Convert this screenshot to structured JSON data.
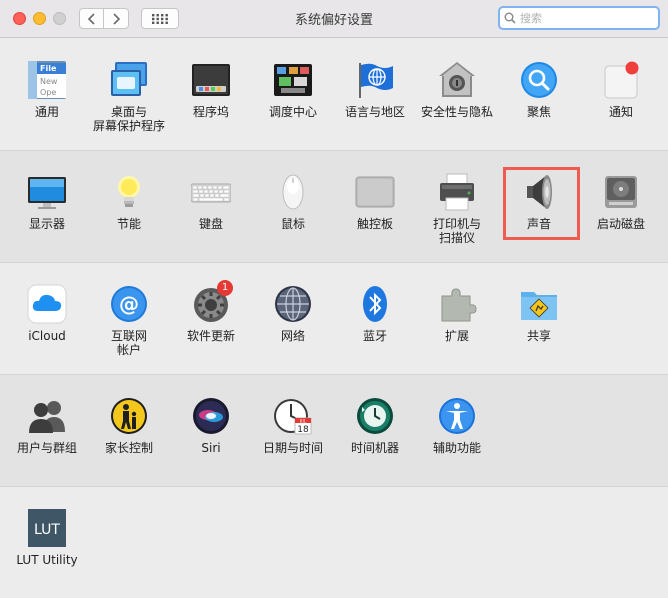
{
  "window": {
    "title": "系统偏好设置",
    "search_placeholder": "搜索"
  },
  "rows": [
    [
      {
        "label": "通用",
        "icon": "general-icon",
        "lines": [
          "通用"
        ]
      },
      {
        "label": "桌面与屏幕保护程序",
        "icon": "desktop-screensaver-icon",
        "lines": [
          "桌面与",
          "屏幕保护程序"
        ]
      },
      {
        "label": "程序坞",
        "icon": "dock-icon",
        "lines": [
          "程序坞"
        ]
      },
      {
        "label": "调度中心",
        "icon": "mission-control-icon",
        "lines": [
          "调度中心"
        ]
      },
      {
        "label": "语言与地区",
        "icon": "language-region-icon",
        "lines": [
          "语言与地区"
        ]
      },
      {
        "label": "安全性与隐私",
        "icon": "security-privacy-icon",
        "lines": [
          "安全性与隐私"
        ]
      },
      {
        "label": "聚焦",
        "icon": "spotlight-icon",
        "lines": [
          "聚焦"
        ]
      },
      {
        "label": "通知",
        "icon": "notifications-icon",
        "lines": [
          "通知"
        ]
      }
    ],
    [
      {
        "label": "显示器",
        "icon": "displays-icon",
        "lines": [
          "显示器"
        ]
      },
      {
        "label": "节能",
        "icon": "energy-saver-icon",
        "lines": [
          "节能"
        ]
      },
      {
        "label": "键盘",
        "icon": "keyboard-icon",
        "lines": [
          "键盘"
        ]
      },
      {
        "label": "鼠标",
        "icon": "mouse-icon",
        "lines": [
          "鼠标"
        ]
      },
      {
        "label": "触控板",
        "icon": "trackpad-icon",
        "lines": [
          "触控板"
        ]
      },
      {
        "label": "打印机与扫描仪",
        "icon": "printer-scanner-icon",
        "lines": [
          "打印机与",
          "扫描仪"
        ]
      },
      {
        "label": "声音",
        "icon": "sound-icon",
        "lines": [
          "声音"
        ]
      },
      {
        "label": "启动磁盘",
        "icon": "startup-disk-icon",
        "lines": [
          "启动磁盘"
        ]
      }
    ],
    [
      {
        "label": "iCloud",
        "icon": "icloud-icon",
        "lines": [
          "iCloud"
        ]
      },
      {
        "label": "互联网帐户",
        "icon": "internet-accounts-icon",
        "lines": [
          "互联网",
          "帐户"
        ]
      },
      {
        "label": "软件更新",
        "icon": "software-update-icon",
        "lines": [
          "软件更新"
        ],
        "badge": "1"
      },
      {
        "label": "网络",
        "icon": "network-icon",
        "lines": [
          "网络"
        ]
      },
      {
        "label": "蓝牙",
        "icon": "bluetooth-icon",
        "lines": [
          "蓝牙"
        ]
      },
      {
        "label": "扩展",
        "icon": "extensions-icon",
        "lines": [
          "扩展"
        ]
      },
      {
        "label": "共享",
        "icon": "sharing-icon",
        "lines": [
          "共享"
        ]
      }
    ],
    [
      {
        "label": "用户与群组",
        "icon": "users-groups-icon",
        "lines": [
          "用户与群组"
        ]
      },
      {
        "label": "家长控制",
        "icon": "parental-controls-icon",
        "lines": [
          "家长控制"
        ]
      },
      {
        "label": "Siri",
        "icon": "siri-icon",
        "lines": [
          "Siri"
        ]
      },
      {
        "label": "日期与时间",
        "icon": "date-time-icon",
        "lines": [
          "日期与时间"
        ],
        "cal_month": "JUL",
        "cal_day": "18"
      },
      {
        "label": "时间机器",
        "icon": "time-machine-icon",
        "lines": [
          "时间机器"
        ]
      },
      {
        "label": "辅助功能",
        "icon": "accessibility-icon",
        "lines": [
          "辅助功能"
        ]
      }
    ],
    [
      {
        "label": "LUT Utility",
        "icon": "lut-utility-icon",
        "lines": [
          "LUT Utility"
        ],
        "icon_text": "LUT"
      }
    ]
  ],
  "general_icon_text": [
    "File",
    "New",
    "Ope"
  ],
  "highlight_color": "#ef5b50"
}
